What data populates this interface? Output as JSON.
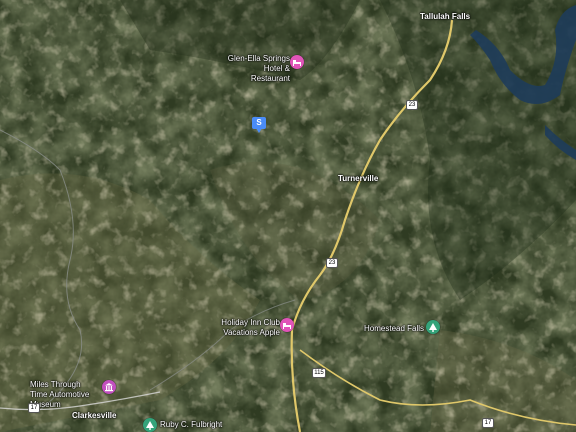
{
  "map": {
    "places": {
      "tallulah_falls": "Tallulah Falls",
      "turnerville": "Turnerville",
      "clarkesville": "Clarkesville"
    },
    "pois": {
      "glen_ella": "Glen-Ella Springs Hotel & Restaurant",
      "holiday_inn": "Holiday Inn Club Vacations Apple",
      "homestead_falls": "Homestead Falls",
      "miles_through_time": "Miles Through Time Automotive Museum",
      "ruby_fulbright": "Ruby C. Fulbright"
    },
    "route_shields": {
      "us23_north": "23",
      "us23_mid": "23",
      "ga115": "115",
      "ga17": "17",
      "ga17_east": "17"
    },
    "pin_label": "S",
    "colors": {
      "hotel_poi": "#e055b8",
      "museum_poi": "#c24fbf",
      "park_poi": "#34a37a",
      "pin": "#4a8cf7",
      "highway": "#e0c86a",
      "water": "#1e3c5a"
    },
    "icons": {
      "hotel": "bed-icon",
      "museum": "museum-icon",
      "park": "tree-icon",
      "pin": "map-pin-icon"
    }
  }
}
